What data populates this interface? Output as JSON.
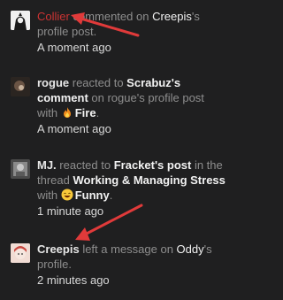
{
  "feed": {
    "items": [
      {
        "user": "Collier",
        "verb": " commented on ",
        "target": "Creepis",
        "suffix": "'s profile post.",
        "time": "A moment ago"
      },
      {
        "user": "rogue",
        "verb": " reacted to ",
        "target1": "Scrabuz's comment",
        "mid": " on rogue's profile post with ",
        "reaction": "Fire",
        "end": ".",
        "time": "A moment ago"
      },
      {
        "user": "MJ.",
        "verb": " reacted to ",
        "target1": "Fracket's post",
        "mid": " in the thread ",
        "thread": "Working & Managing Stress",
        "with": " with ",
        "reaction": "Funny",
        "end": ".",
        "time": "1 minute ago"
      },
      {
        "user": "Creepis",
        "verb": " left a message on ",
        "target": "Oddy",
        "suffix": "'s profile.",
        "time": "2 minutes ago"
      }
    ]
  },
  "colors": {
    "background": "#1f1f20",
    "arrow": "#e03a3a",
    "username_red": "#cc3333"
  }
}
